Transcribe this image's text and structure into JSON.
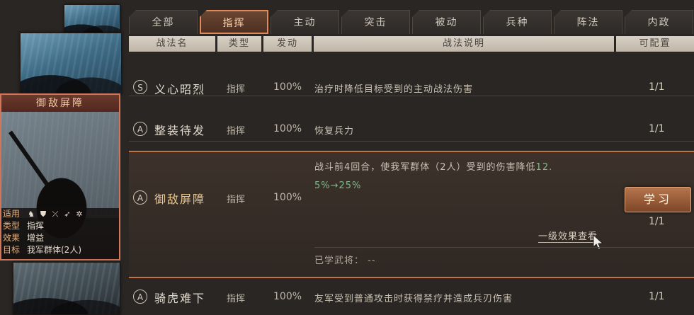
{
  "tabs": [
    {
      "label": "全部",
      "active": false
    },
    {
      "label": "指挥",
      "active": true
    },
    {
      "label": "主动",
      "active": false
    },
    {
      "label": "突击",
      "active": false
    },
    {
      "label": "被动",
      "active": false
    },
    {
      "label": "兵种",
      "active": false
    },
    {
      "label": "阵法",
      "active": false
    },
    {
      "label": "内政",
      "active": false
    }
  ],
  "columns": {
    "name": "战法名",
    "type": "类型",
    "rate": "发动",
    "desc": "战法说明",
    "cfg": "可配置"
  },
  "card": {
    "title": "御敌屏障",
    "fields": [
      {
        "k": "适用",
        "v": ""
      },
      {
        "k": "类型",
        "v": "指挥"
      },
      {
        "k": "效果",
        "v": "增益"
      },
      {
        "k": "目标",
        "v": "我军群体(2人)"
      }
    ],
    "unit_icons": [
      "cavalry-icon",
      "shield-icon",
      "bow-icon",
      "spear-icon",
      "wheel-icon"
    ]
  },
  "rows": [
    {
      "grade": "S",
      "name": "义心昭烈",
      "type": "指挥",
      "rate": "100%",
      "desc": "治疗时降低目标受到的主动战法伤害",
      "cfg": "1/1"
    },
    {
      "grade": "A",
      "name": "整装待发",
      "type": "指挥",
      "rate": "100%",
      "desc": "恢复兵力",
      "cfg": "1/1"
    },
    {
      "grade": "A",
      "name": "御敌屏障",
      "type": "指挥",
      "rate": "100%",
      "desc_line1": "战斗前4回合，使我军群体（2人）受到的伤害降低",
      "desc_line1_val": "12.",
      "desc_line2": "5%→25%",
      "cfg": "1/1",
      "learn_label": "学习",
      "level_link": "一级效果查看",
      "learned_label": "已学武将：  --"
    },
    {
      "grade": "A",
      "name": "骑虎难下",
      "type": "指挥",
      "rate": "100%",
      "desc": "友军受到普通攻击时获得禁疗并造成兵刃伤害",
      "cfg": "1/1"
    }
  ]
}
